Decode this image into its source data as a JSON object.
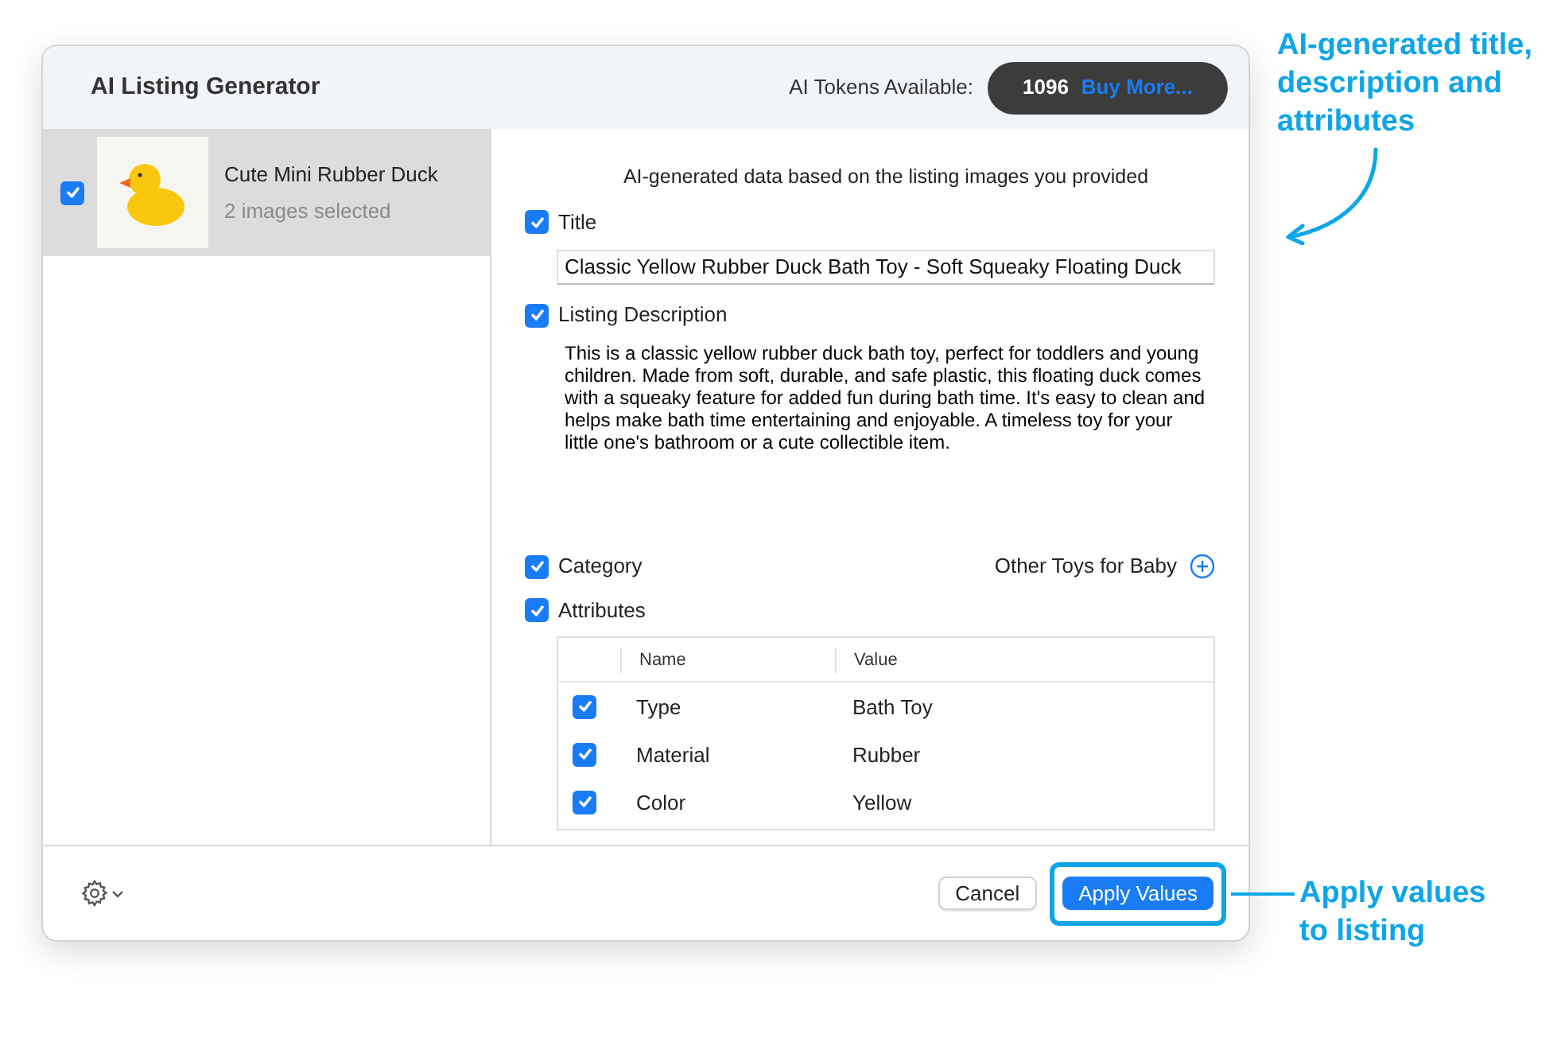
{
  "window": {
    "title": "AI Listing Generator"
  },
  "tokens": {
    "label": "AI Tokens Available:",
    "count": "1096",
    "buy_link": "Buy More..."
  },
  "listings": [
    {
      "name": "Cute Mini Rubber Duck",
      "subtitle": "2 images selected",
      "checked": true,
      "selected": true
    }
  ],
  "intro": "AI-generated data based on the listing images you provided",
  "fields": [
    {
      "kind": "text",
      "label": "Title",
      "checked": true,
      "value": "Classic Yellow Rubber Duck Bath Toy - Soft Squeaky Floating Duck"
    },
    {
      "kind": "paragraph",
      "label": "Listing Description",
      "checked": true,
      "value": "This is a classic yellow rubber duck bath toy, perfect for toddlers and young children. Made from soft, durable, and safe plastic, this floating duck comes with a squeaky feature for added fun during bath time. It's easy to clean and helps make bath time entertaining and enjoyable. A timeless toy for your little one's bathroom or a cute collectible item."
    },
    {
      "kind": "category",
      "label": "Category",
      "checked": true,
      "value": "Other Toys for Baby"
    },
    {
      "kind": "table",
      "label": "Attributes",
      "checked": true,
      "columns": [
        "Name",
        "Value"
      ],
      "rows": [
        {
          "name": "Type",
          "value": "Bath Toy",
          "checked": true
        },
        {
          "name": "Material",
          "value": "Rubber",
          "checked": true
        },
        {
          "name": "Color",
          "value": "Yellow",
          "checked": true
        }
      ]
    }
  ],
  "footer": {
    "buttons": [
      {
        "label": "Cancel",
        "primary": false
      },
      {
        "label": "Apply Values",
        "primary": true
      }
    ]
  },
  "annotations": [
    {
      "text": "AI-generated title, description and attributes"
    },
    {
      "text": "Apply values to listing"
    }
  ]
}
